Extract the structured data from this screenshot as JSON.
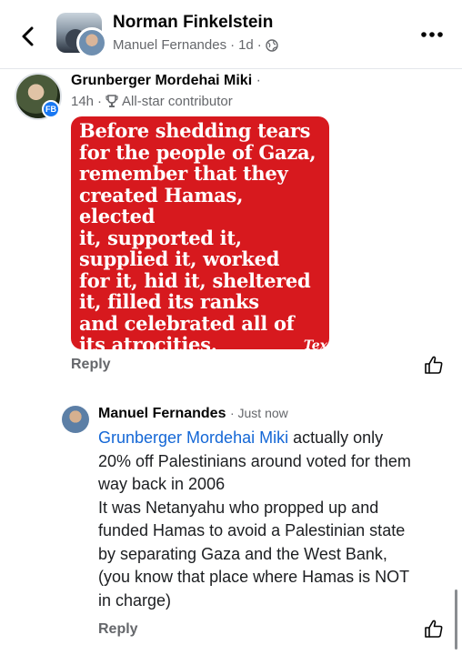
{
  "header": {
    "title": "Norman Finkelstein",
    "subtitle_author": "Manuel Fernandes",
    "subtitle_time": "1d",
    "icons": {
      "back": "chevron-left-icon",
      "audience": "globe-icon",
      "more": "more-horizontal-icon"
    }
  },
  "comment1": {
    "author": "Grunberger Mordehai Miki",
    "time": "14h",
    "badge": "All-star contributor",
    "avatar_badge_text": "FB",
    "image_text": "Before shedding tears\nfor the people of Gaza,\nremember that they\ncreated Hamas, elected\nit, supported it,\nsupplied it, worked\nfor it, hid it, sheltered\nit, filled its ranks\nand celebrated all of\nits atrocities.",
    "image_watermark": "Tex",
    "reply_label": "Reply"
  },
  "comment2": {
    "author": "Manuel Fernandes",
    "time": "Just now",
    "mention": "Grunberger Mordehai Miki",
    "lines": [
      " actually only",
      "20% off Palestinians around voted for them",
      "way back in 2006",
      "It was Netanyahu  who propped up and",
      "funded Hamas to avoid a Palestinian state",
      "by separating Gaza and the West Bank,",
      "(you know that place where Hamas is NOT",
      "in charge)"
    ],
    "reply_label": "Reply"
  },
  "colors": {
    "meme_red": "#d7191e",
    "link_blue": "#1467d6",
    "muted": "#65676b"
  }
}
